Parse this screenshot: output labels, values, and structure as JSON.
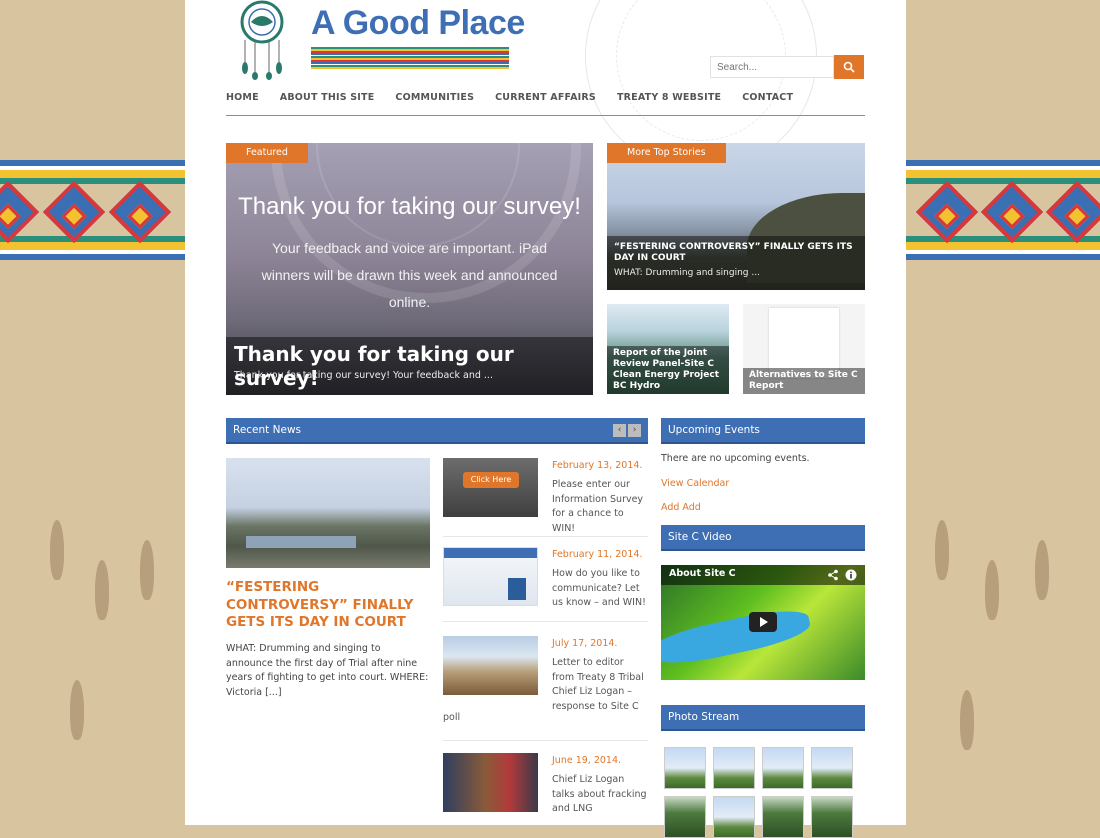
{
  "site": {
    "title": "A Good Place"
  },
  "search": {
    "placeholder": "Search..."
  },
  "nav": [
    "HOME",
    "ABOUT THIS SITE",
    "COMMUNITIES",
    "CURRENT AFFAIRS",
    "TREATY 8 WEBSITE",
    "CONTACT"
  ],
  "featured": {
    "tag": "Featured",
    "headline": "Thank you for taking our survey!",
    "subtext": "Your feedback and voice are important. iPad winners will be drawn this week and announced online.",
    "caption_title": "Thank you for taking our survey!",
    "caption_text": "Thank you for taking our survey! Your feedback and ..."
  },
  "top_stories": {
    "tag": "More Top Stories",
    "main": {
      "title": "“FESTERING CONTROVERSY” FINALLY GETS ITS DAY IN COURT",
      "text": "WHAT:              Drumming and singing ..."
    },
    "thumb1": "Report of the Joint Review Panel-Site C Clean Energy Project BC Hydro",
    "thumb2": "Alternatives to Site C Report"
  },
  "recent_news": {
    "heading": "Recent News",
    "lead": {
      "title": "“FESTERING CONTROVERSY” FINALLY GETS ITS DAY IN COURT",
      "excerpt": "WHAT:              Drumming and singing to announce the first day of Trial after nine years of fighting to get into court.    WHERE:           Victoria [...]"
    },
    "items": [
      {
        "date": "February 13, 2014.",
        "text": "Please enter our Information Survey for a chance to WIN!",
        "tail": "",
        "thumb_label": "Click Here"
      },
      {
        "date": "February 11, 2014.",
        "text": "How do you like to communicate? Let us know – and WIN!",
        "tail": ""
      },
      {
        "date": "July 17, 2014.",
        "text": "Letter to editor from Treaty 8 Tribal Chief Liz Logan – response to Site C",
        "tail": "poll"
      },
      {
        "date": "June 19, 2014.",
        "text": "Chief Liz Logan talks about fracking and LNG",
        "tail": ""
      }
    ]
  },
  "events": {
    "heading": "Upcoming Events",
    "empty": "There are no upcoming events.",
    "view_calendar": "View Calendar",
    "add": "Add Add"
  },
  "video": {
    "heading": "Site C Video",
    "title": "About Site C"
  },
  "photostream": {
    "heading": "Photo Stream"
  },
  "colors": {
    "accent": "#e0762a",
    "brand_blue": "#3e6fb5"
  }
}
